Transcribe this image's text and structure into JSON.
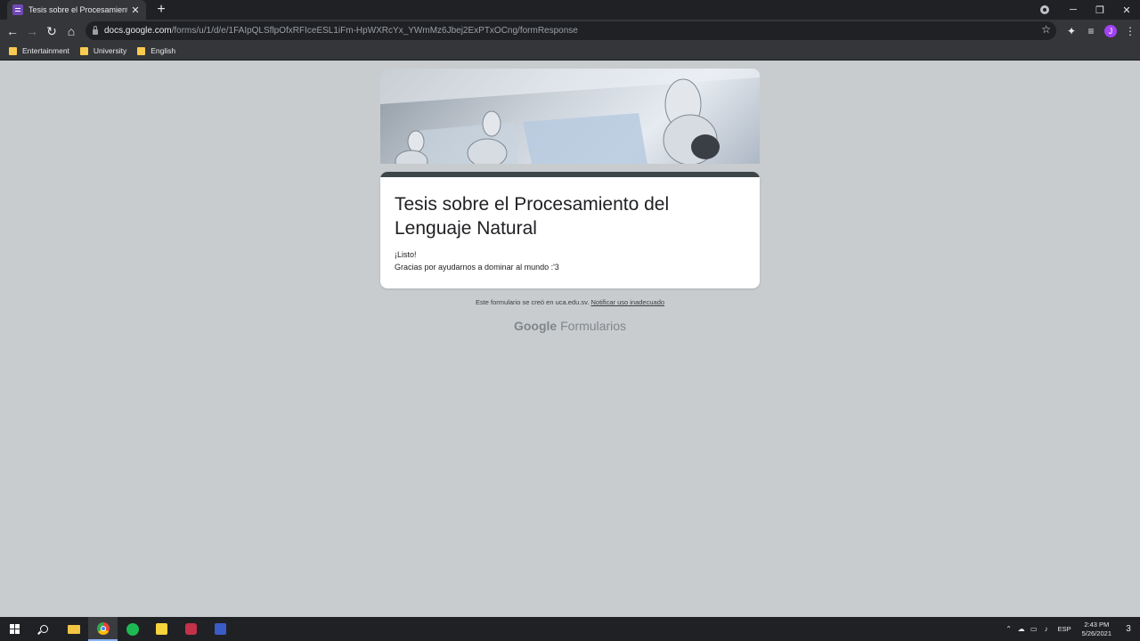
{
  "browser": {
    "tab_title": "Tesis sobre el Procesamiento del",
    "tab_close": "✕",
    "new_tab": "+",
    "url_host": "docs.google.com",
    "url_path": "/forms/u/1/d/e/1FAIpQLSflpOfxRFIceESL1iFm-HpWXRcYx_YWmMz6Jbej2ExPTxOCng/formResponse",
    "profile_initial": "J",
    "bookmarks": [
      "Entertainment",
      "University",
      "English"
    ]
  },
  "form": {
    "title": "Tesis sobre el Procesamiento del Lenguaje Natural",
    "message_line1": "¡Listo!",
    "message_line2": "Gracias por ayudarnos a dominar al mundo :'3",
    "footer_text": "Este formulario se creó en uca.edu.sv.",
    "footer_link": "Notificar uso inadecuado",
    "brand_google": "Google",
    "brand_product": "Formularios"
  },
  "taskbar": {
    "language": "ESP",
    "time": "2:43 PM",
    "date": "5/26/2021",
    "notification_count": "3"
  },
  "colors": {
    "page_background": "#c9ccce",
    "card_header": "#3d4548",
    "chrome_dark": "#202124"
  }
}
